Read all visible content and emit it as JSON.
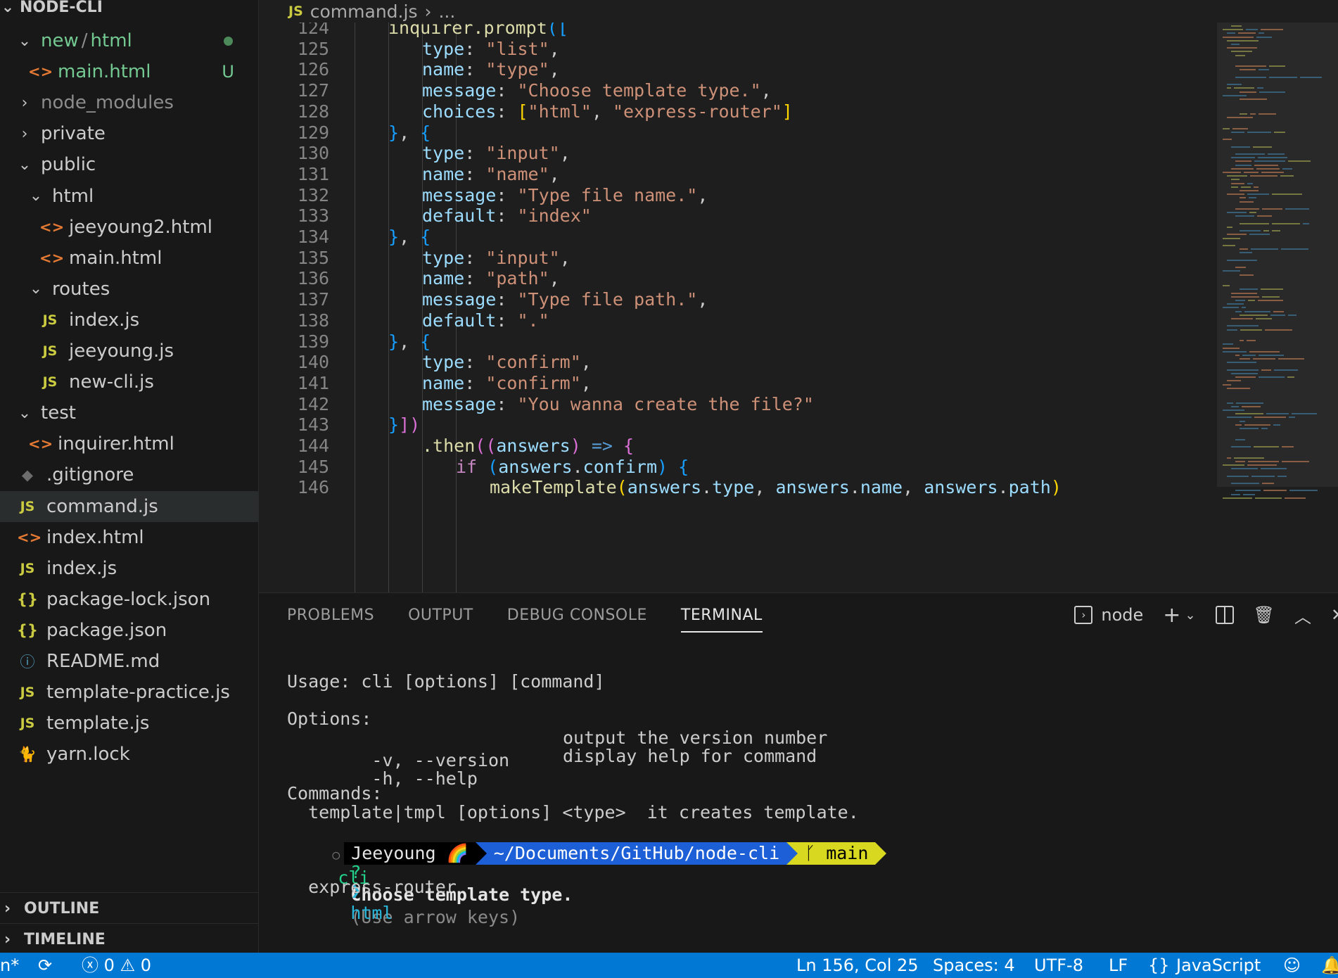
{
  "explorer": {
    "root": "NODE-CLI",
    "items": [
      {
        "label": "new",
        "sep": "/",
        "label2": "html",
        "type": "folder",
        "depth": 1,
        "open": true,
        "status": "dot"
      },
      {
        "label": "main.html",
        "type": "html",
        "depth": 2,
        "status": "U"
      },
      {
        "label": "node_modules",
        "type": "folder",
        "depth": 1,
        "open": false
      },
      {
        "label": "private",
        "type": "folder",
        "depth": 1,
        "open": false
      },
      {
        "label": "public",
        "type": "folder",
        "depth": 1,
        "open": true
      },
      {
        "label": "html",
        "type": "folder",
        "depth": 2,
        "open": true
      },
      {
        "label": "jeeyoung2.html",
        "type": "html",
        "depth": 3
      },
      {
        "label": "main.html",
        "type": "html",
        "depth": 3
      },
      {
        "label": "routes",
        "type": "folder",
        "depth": 2,
        "open": true
      },
      {
        "label": "index.js",
        "type": "js",
        "depth": 3
      },
      {
        "label": "jeeyoung.js",
        "type": "js",
        "depth": 3
      },
      {
        "label": "new-cli.js",
        "type": "js",
        "depth": 3
      },
      {
        "label": "test",
        "type": "folder",
        "depth": 1,
        "open": true
      },
      {
        "label": "inquirer.html",
        "type": "html",
        "depth": 2
      },
      {
        "label": ".gitignore",
        "type": "git",
        "depth": 1
      },
      {
        "label": "command.js",
        "type": "js",
        "depth": 1,
        "selected": true
      },
      {
        "label": "index.html",
        "type": "html",
        "depth": 1
      },
      {
        "label": "index.js",
        "type": "js",
        "depth": 1
      },
      {
        "label": "package-lock.json",
        "type": "json",
        "depth": 1
      },
      {
        "label": "package.json",
        "type": "json",
        "depth": 1
      },
      {
        "label": "README.md",
        "type": "info",
        "depth": 1
      },
      {
        "label": "template-practice.js",
        "type": "js",
        "depth": 1
      },
      {
        "label": "template.js",
        "type": "js",
        "depth": 1
      },
      {
        "label": "yarn.lock",
        "type": "yarn",
        "depth": 1
      }
    ],
    "outline": "OUTLINE",
    "timeline": "TIMELINE"
  },
  "breadcrumb": {
    "icon": "JS",
    "file": "command.js",
    "sep": "›",
    "rest": "..."
  },
  "editor": {
    "lines": [
      {
        "n": "124",
        "indent": 2,
        "tokens": [
          [
            "fn",
            "inquirer.prompt"
          ],
          [
            "b1",
            "(["
          ]
        ]
      },
      {
        "n": "125",
        "indent": 3,
        "tokens": [
          [
            "key",
            "type"
          ],
          [
            "punc",
            ": "
          ],
          [
            "str",
            "\"list\""
          ],
          [
            "punc",
            ","
          ]
        ]
      },
      {
        "n": "126",
        "indent": 3,
        "tokens": [
          [
            "key",
            "name"
          ],
          [
            "punc",
            ": "
          ],
          [
            "str",
            "\"type\""
          ],
          [
            "punc",
            ","
          ]
        ]
      },
      {
        "n": "127",
        "indent": 3,
        "tokens": [
          [
            "key",
            "message"
          ],
          [
            "punc",
            ": "
          ],
          [
            "str",
            "\"Choose template type.\""
          ],
          [
            "punc",
            ","
          ]
        ]
      },
      {
        "n": "128",
        "indent": 3,
        "tokens": [
          [
            "key",
            "choices"
          ],
          [
            "punc",
            ": "
          ],
          [
            "b3",
            "["
          ],
          [
            "str",
            "\"html\""
          ],
          [
            "punc",
            ", "
          ],
          [
            "str",
            "\"express-router\""
          ],
          [
            "b3",
            "]"
          ]
        ]
      },
      {
        "n": "129",
        "indent": 2,
        "tokens": [
          [
            "b1",
            "}"
          ],
          [
            "punc",
            ", "
          ],
          [
            "b1",
            "{"
          ]
        ]
      },
      {
        "n": "130",
        "indent": 3,
        "tokens": [
          [
            "key",
            "type"
          ],
          [
            "punc",
            ": "
          ],
          [
            "str",
            "\"input\""
          ],
          [
            "punc",
            ","
          ]
        ]
      },
      {
        "n": "131",
        "indent": 3,
        "tokens": [
          [
            "key",
            "name"
          ],
          [
            "punc",
            ": "
          ],
          [
            "str",
            "\"name\""
          ],
          [
            "punc",
            ","
          ]
        ]
      },
      {
        "n": "132",
        "indent": 3,
        "tokens": [
          [
            "key",
            "message"
          ],
          [
            "punc",
            ": "
          ],
          [
            "str",
            "\"Type file name.\""
          ],
          [
            "punc",
            ","
          ]
        ]
      },
      {
        "n": "133",
        "indent": 3,
        "tokens": [
          [
            "key",
            "default"
          ],
          [
            "punc",
            ": "
          ],
          [
            "str",
            "\"index\""
          ]
        ]
      },
      {
        "n": "134",
        "indent": 2,
        "tokens": [
          [
            "b1",
            "}"
          ],
          [
            "punc",
            ", "
          ],
          [
            "b1",
            "{"
          ]
        ]
      },
      {
        "n": "135",
        "indent": 3,
        "tokens": [
          [
            "key",
            "type"
          ],
          [
            "punc",
            ": "
          ],
          [
            "str",
            "\"input\""
          ],
          [
            "punc",
            ","
          ]
        ]
      },
      {
        "n": "136",
        "indent": 3,
        "tokens": [
          [
            "key",
            "name"
          ],
          [
            "punc",
            ": "
          ],
          [
            "str",
            "\"path\""
          ],
          [
            "punc",
            ","
          ]
        ]
      },
      {
        "n": "137",
        "indent": 3,
        "tokens": [
          [
            "key",
            "message"
          ],
          [
            "punc",
            ": "
          ],
          [
            "str",
            "\"Type file path.\""
          ],
          [
            "punc",
            ","
          ]
        ]
      },
      {
        "n": "138",
        "indent": 3,
        "tokens": [
          [
            "key",
            "default"
          ],
          [
            "punc",
            ": "
          ],
          [
            "str",
            "\".\""
          ]
        ]
      },
      {
        "n": "139",
        "indent": 2,
        "tokens": [
          [
            "b1",
            "}"
          ],
          [
            "punc",
            ", "
          ],
          [
            "b1",
            "{"
          ]
        ]
      },
      {
        "n": "140",
        "indent": 3,
        "tokens": [
          [
            "key",
            "type"
          ],
          [
            "punc",
            ": "
          ],
          [
            "str",
            "\"confirm\""
          ],
          [
            "punc",
            ","
          ]
        ]
      },
      {
        "n": "141",
        "indent": 3,
        "tokens": [
          [
            "key",
            "name"
          ],
          [
            "punc",
            ": "
          ],
          [
            "str",
            "\"confirm\""
          ],
          [
            "punc",
            ","
          ]
        ]
      },
      {
        "n": "142",
        "indent": 3,
        "tokens": [
          [
            "key",
            "message"
          ],
          [
            "punc",
            ": "
          ],
          [
            "str",
            "\"You wanna create the file?\""
          ]
        ]
      },
      {
        "n": "143",
        "indent": 2,
        "tokens": [
          [
            "b1",
            "}"
          ],
          [
            "b2",
            "])"
          ]
        ]
      },
      {
        "n": "144",
        "indent": 3,
        "tokens": [
          [
            "fn",
            ".then"
          ],
          [
            "b2",
            "(("
          ],
          [
            "key",
            "answers"
          ],
          [
            "b2",
            ")"
          ],
          [
            "op",
            " => "
          ],
          [
            "b2",
            "{"
          ]
        ]
      },
      {
        "n": "145",
        "indent": 4,
        "tokens": [
          [
            "kw",
            "if"
          ],
          [
            "punc",
            " "
          ],
          [
            "b1",
            "("
          ],
          [
            "key",
            "answers"
          ],
          [
            "punc",
            "."
          ],
          [
            "key",
            "confirm"
          ],
          [
            "b1",
            ")"
          ],
          [
            "punc",
            " "
          ],
          [
            "b1",
            "{"
          ]
        ]
      },
      {
        "n": "146",
        "indent": 5,
        "tokens": [
          [
            "fn",
            "makeTemplate"
          ],
          [
            "b3",
            "("
          ],
          [
            "key",
            "answers"
          ],
          [
            "punc",
            "."
          ],
          [
            "key",
            "type"
          ],
          [
            "punc",
            ", "
          ],
          [
            "key",
            "answers"
          ],
          [
            "punc",
            "."
          ],
          [
            "key",
            "name"
          ],
          [
            "punc",
            ", "
          ],
          [
            "key",
            "answers"
          ],
          [
            "punc",
            "."
          ],
          [
            "key",
            "path"
          ],
          [
            "b3",
            ")"
          ]
        ]
      }
    ]
  },
  "panel": {
    "tabs": [
      "PROBLEMS",
      "OUTPUT",
      "DEBUG CONSOLE",
      "TERMINAL"
    ],
    "active_tab": "TERMINAL",
    "terminal_name": "node",
    "terminal": {
      "usage": "Usage: cli [options] [command]",
      "options_header": "Options:",
      "options": [
        {
          "flag": "  -v, --version",
          "desc": "output the version number"
        },
        {
          "flag": "  -h, --help",
          "desc": "display help for command"
        }
      ],
      "commands_header": "Commands:",
      "command_line": "  template|tmpl [options] <type>  it creates template.",
      "prompt_user": "Jeeyoung 🌈",
      "prompt_path": "~/Documents/GitHub/node-cli",
      "prompt_git": " main",
      "prompt_cmd": "cli",
      "question_mark": "?",
      "question": "Choose template type.",
      "hint": "(Use arrow keys)",
      "pointer": "❯",
      "choice_selected": "html",
      "choice_other": "  express-router"
    }
  },
  "statusbar": {
    "left_partial": "n*",
    "errors": "0",
    "warnings": "0",
    "cursor": "Ln 156, Col 25",
    "spaces": "Spaces: 4",
    "encoding": "UTF-8",
    "eol": "LF",
    "braces": "{}",
    "language": "JavaScript"
  }
}
